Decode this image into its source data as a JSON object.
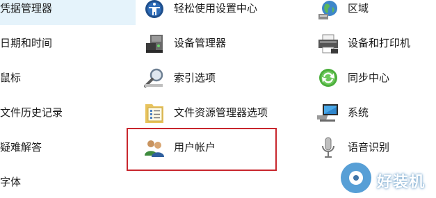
{
  "left_column": [
    {
      "label": "凭据管理器",
      "selected": true
    },
    {
      "label": "日期和时间"
    },
    {
      "label": "鼠标"
    },
    {
      "label": "文件历史记录"
    },
    {
      "label": "疑难解答"
    },
    {
      "label": "字体"
    }
  ],
  "middle_column": [
    {
      "label": "轻松使用设置中心",
      "icon": "ease-of-access-icon"
    },
    {
      "label": "设备管理器",
      "icon": "device-manager-icon"
    },
    {
      "label": "索引选项",
      "icon": "indexing-options-icon"
    },
    {
      "label": "文件资源管理器选项",
      "icon": "folder-options-icon"
    },
    {
      "label": "用户帐户",
      "icon": "user-accounts-icon",
      "highlighted": true
    }
  ],
  "right_column": [
    {
      "label": "区域",
      "icon": "region-globe-icon"
    },
    {
      "label": "设备和打印机",
      "icon": "printer-icon"
    },
    {
      "label": "同步中心",
      "icon": "sync-center-icon"
    },
    {
      "label": "系统",
      "icon": "system-monitor-icon"
    },
    {
      "label": "语音识别",
      "icon": "microphone-icon"
    }
  ],
  "watermark": {
    "text": "好装机"
  },
  "colors": {
    "highlight": "#e5f3fb",
    "red_box": "#c8262d"
  }
}
